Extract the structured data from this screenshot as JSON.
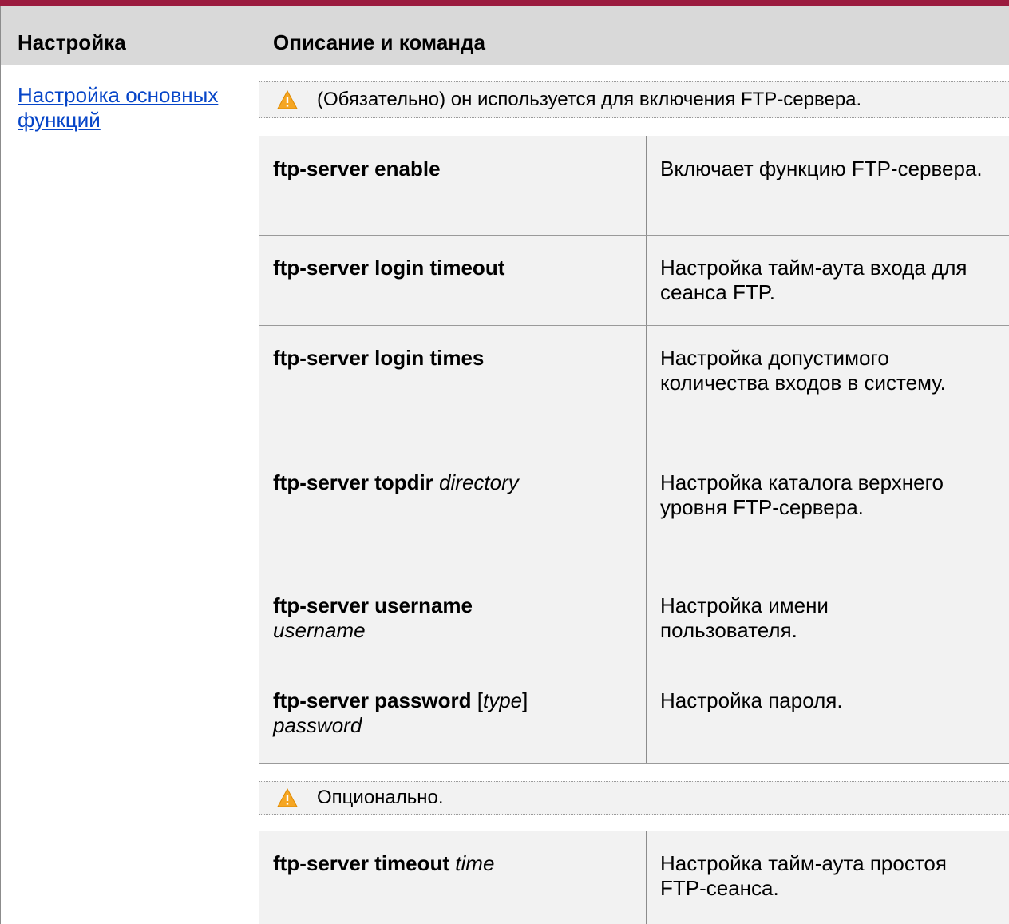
{
  "header": {
    "col1": "Настройка",
    "col2": "Описание и команда"
  },
  "section": {
    "link": "Настройка основных функций"
  },
  "notes": {
    "required": "(Обязательно) он используется для включения FTP-сервера.",
    "optional": "Опционально."
  },
  "rows": [
    {
      "cmd_bold": "ftp-server enable",
      "cmd_italic": "",
      "desc": "Включает функцию FTP-сервера."
    },
    {
      "cmd_bold": "ftp-server login timeout",
      "cmd_italic": "",
      "desc": "Настройка тайм-аута входа для сеанса FTP."
    },
    {
      "cmd_bold": "ftp-server login times",
      "cmd_italic": "",
      "desc": "Настройка допустимого количества входов в систему."
    },
    {
      "cmd_bold": "ftp-server topdir",
      "cmd_italic": "directory",
      "desc": "Настройка каталога верхнего уровня FTP-сервера."
    },
    {
      "cmd_bold": "ftp-server username",
      "cmd_italic": "username",
      "desc": "Настройка имени пользователя."
    },
    {
      "cmd_bold": "ftp-server password",
      "cmd_open": " [",
      "cmd_italic": "type",
      "cmd_close": "]",
      "cmd_italic2": "password",
      "desc": "Настройка пароля."
    },
    {
      "cmd_bold": "ftp-server timeout",
      "cmd_italic": "time",
      "desc": "Настройка тайм-аута простоя FTP-сеанса."
    }
  ],
  "colors": {
    "rule": "#9b1b3f",
    "header_bg": "#d9d9d9",
    "row_bg": "#f2f2f2",
    "link": "#0645c8",
    "warning": "#f5a623"
  }
}
